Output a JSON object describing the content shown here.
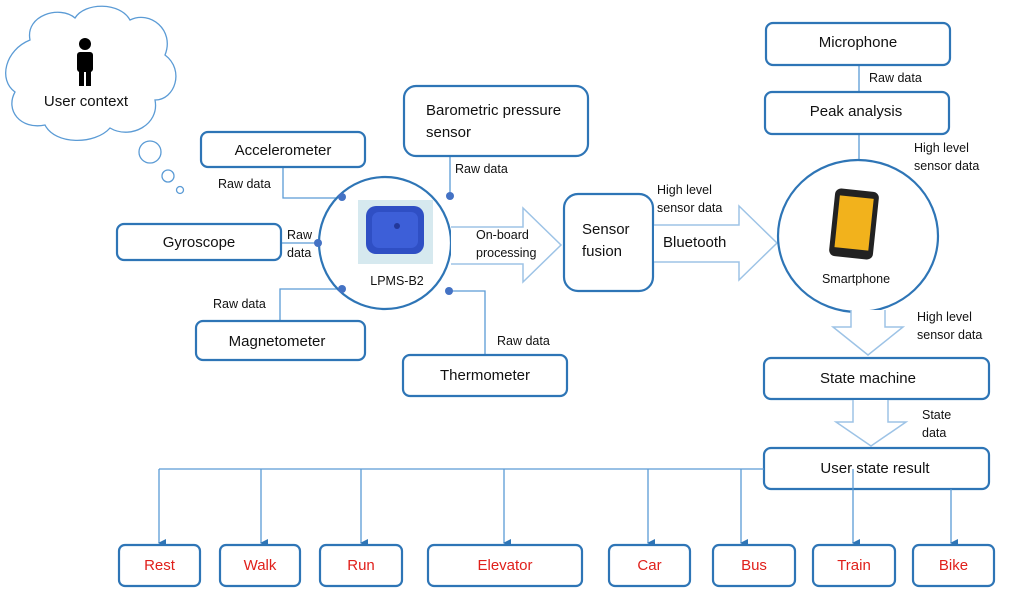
{
  "colors": {
    "box_border": "#2e75b6",
    "connector": "#5b9bd5",
    "arrow_outline": "#9dc3e6",
    "state_text": "#e0201b"
  },
  "cloud": {
    "label": "User context",
    "icon": "person-icon"
  },
  "sensors": {
    "accelerometer": "Accelerometer",
    "gyroscope": "Gyroscope",
    "magnetometer": "Magnetometer",
    "barometric_line1": "Barometric pressure",
    "barometric_line2": "sensor",
    "thermometer": "Thermometer"
  },
  "device": {
    "label": "LPMS-B2",
    "icon": "imu-device-icon"
  },
  "labels": {
    "raw_data": "Raw data",
    "raw": "Raw",
    "data": "data",
    "onboard1": "On-board",
    "onboard2": "processing",
    "high1": "High level",
    "high2": "sensor data",
    "bluetooth": "Bluetooth",
    "state1": "State",
    "state2": "data"
  },
  "fusion": {
    "line1": "Sensor",
    "line2": "fusion"
  },
  "phone": {
    "label": "Smartphone",
    "icon": "smartphone-icon"
  },
  "microphone": "Microphone",
  "peak": "Peak analysis",
  "state_machine": "State machine",
  "user_state": "User state result",
  "states": [
    "Rest",
    "Walk",
    "Run",
    "Elevator",
    "Car",
    "Bus",
    "Train",
    "Bike"
  ]
}
